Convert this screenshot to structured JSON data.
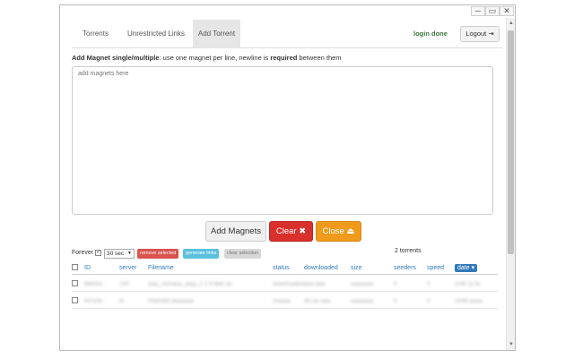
{
  "window": {
    "min": "─",
    "max": "▭",
    "close": "✕"
  },
  "nav": {
    "tabs": [
      "Torrents",
      "Unrestricted Links",
      "Add Torrent"
    ],
    "status": "login done",
    "logout": "Logout"
  },
  "form": {
    "label_prefix": "Add Magnet single/multiple",
    "label_mid": ": use one magnet per line, newline is ",
    "label_bold": "required",
    "label_suffix": " between them",
    "placeholder": "add magnets here"
  },
  "buttons": {
    "add": "Add Magnets",
    "clear": "Clear",
    "close": "Close"
  },
  "controls": {
    "forever": "Forever",
    "interval": "30 sec",
    "remove": "remove selected",
    "generate": "generate links",
    "clear_sel": "clear selection",
    "count": "2 torrents"
  },
  "table": {
    "headers": [
      "ID",
      "server",
      "Filename",
      "status",
      "downloaded",
      "size",
      "seeders",
      "speed",
      "date"
    ],
    "rows": [
      [
        "lbfd0ec",
        "140",
        "aaa_namaaa_aiqa_1 1 6 bbb aa",
        "downloaded",
        "aaa aaa",
        "aaaaaaa",
        "0",
        "0",
        "1/48 11 lb"
      ],
      [
        "lb7m5v",
        "lb",
        "Fbbnfdd aaaaaaa",
        "lnaaaa",
        "4A aa aaa",
        "aaaaaaa",
        "0",
        "0",
        "n048 aaaa"
      ]
    ]
  }
}
